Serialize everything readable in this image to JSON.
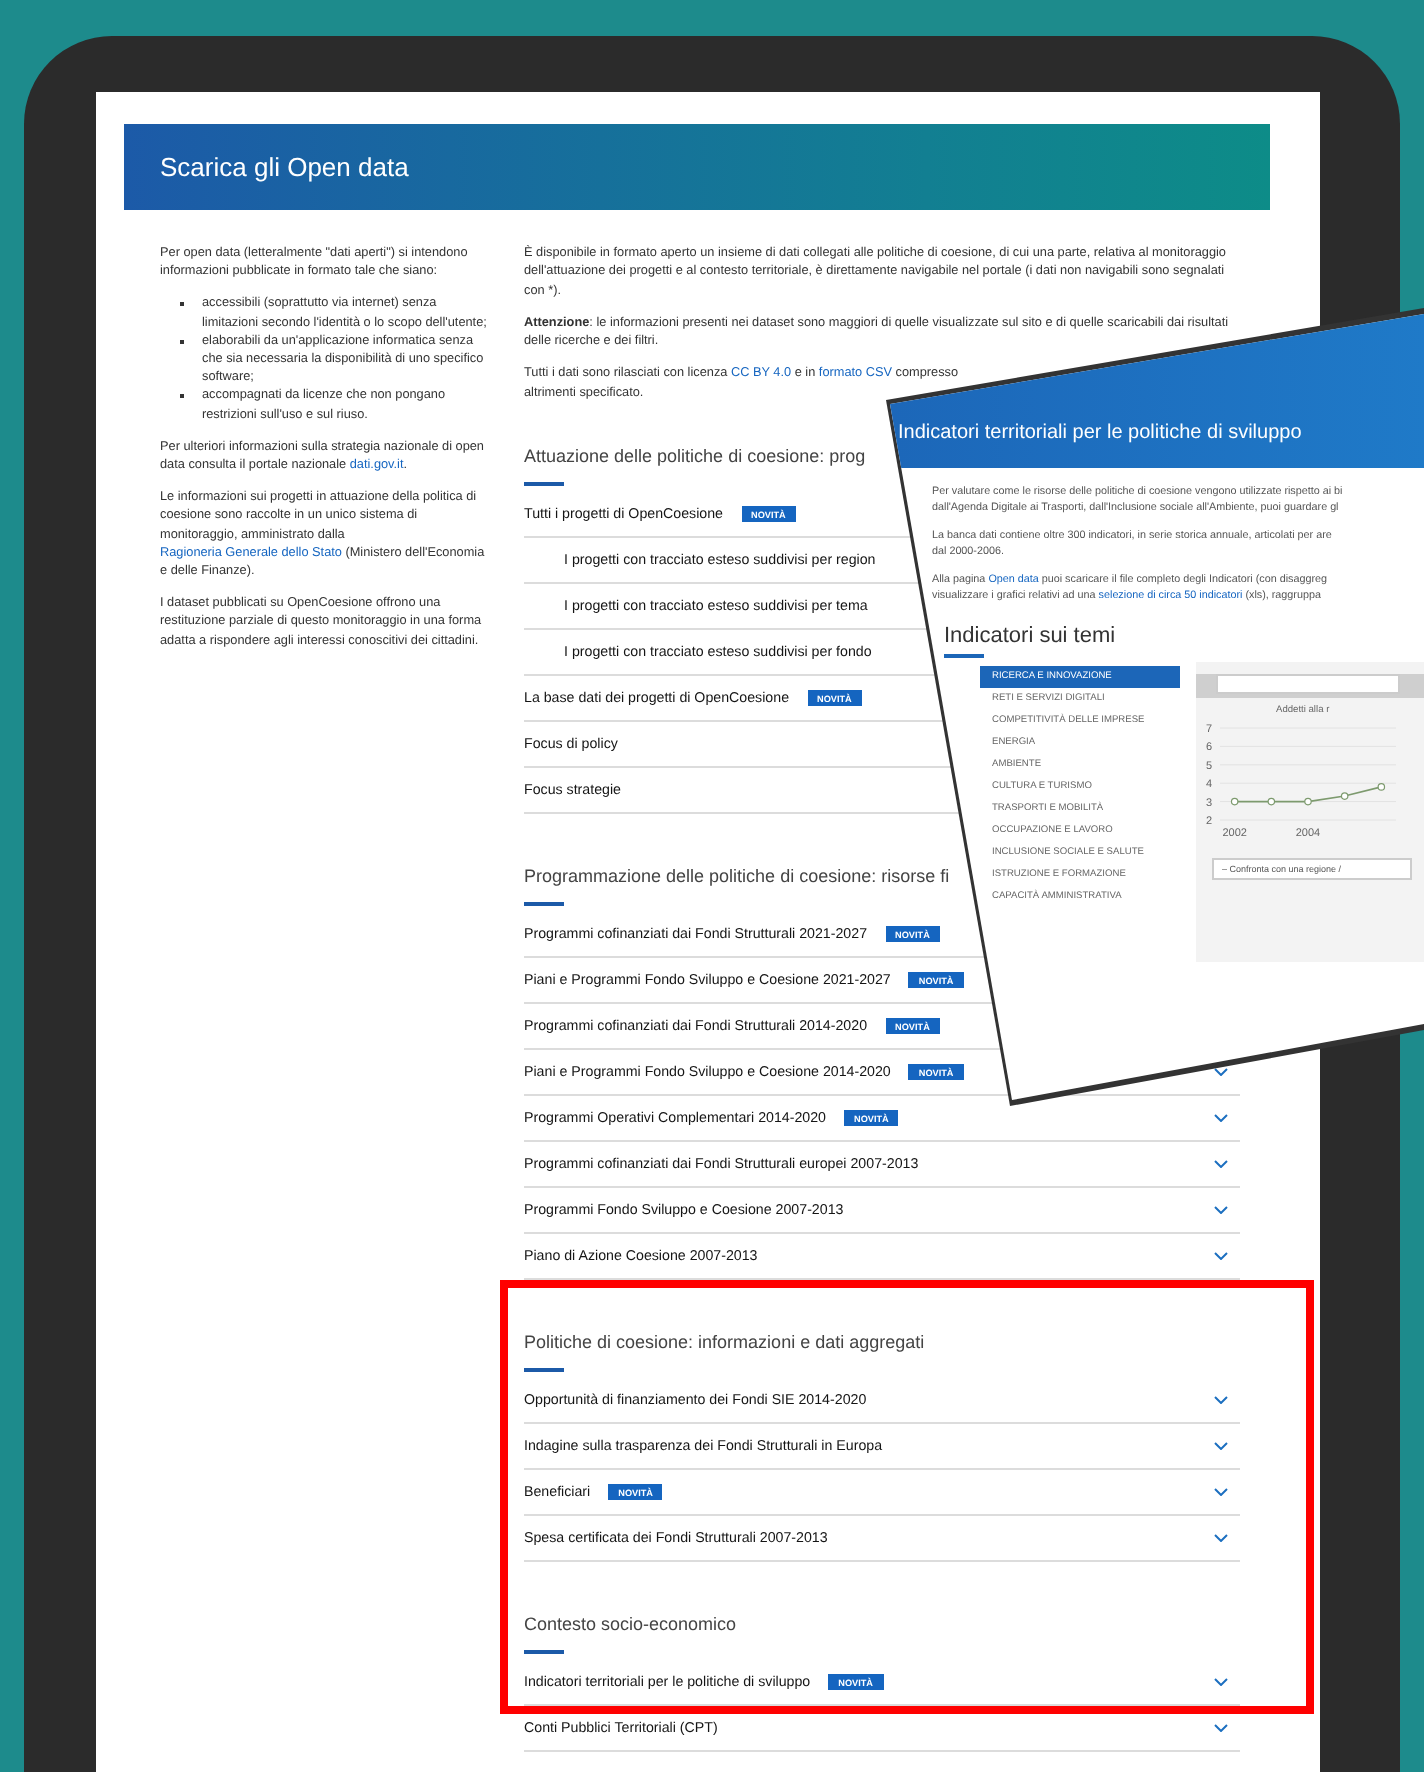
{
  "header": {
    "title": "Scarica gli Open data"
  },
  "left_column": {
    "intro": "Per open data (letteralmente \"dati aperti\") si intendono informazioni pubblicate in formato tale che siano:",
    "bullets": [
      "accessibili (soprattutto via internet) senza limitazioni secondo l'identità o lo scopo dell'utente;",
      "elaborabili da un'applicazione informatica senza che sia necessaria la disponibilità di uno specifico software;",
      "accompagnati da licenze che non pongano restrizioni sull'uso e sul riuso."
    ],
    "paragraphs": [
      [
        {
          "kind": "text",
          "text": "Per ulteriori informazioni sulla strategia nazionale di open data consulta il portale nazionale "
        },
        {
          "kind": "link",
          "text": "dati.gov.it"
        },
        {
          "kind": "text",
          "text": "."
        }
      ],
      [
        {
          "kind": "text",
          "text": "Le informazioni sui progetti in attuazione della politica di coesione sono raccolte in un unico sistema di monitoraggio, amministrato dalla "
        },
        {
          "kind": "link",
          "text": "Ragioneria Generale dello Stato"
        },
        {
          "kind": "text",
          "text": " (Ministero dell'Economia e delle Finanze)."
        }
      ],
      [
        {
          "kind": "text",
          "text": "I dataset pubblicati su OpenCoesione offrono una restituzione parziale di questo monitoraggio in una forma adatta a rispondere agli interessi conoscitivi dei cittadini."
        }
      ]
    ]
  },
  "right_column": {
    "paragraphs": [
      [
        {
          "kind": "text",
          "text": "È disponibile in formato aperto un insieme di dati collegati alle politiche di coesione, di cui una parte, relativa al monitoraggio dell'attuazione dei progetti e al contesto territoriale, è direttamente navigabile nel portale (i dati non navigabili sono segnalati con *)."
        }
      ],
      [
        {
          "kind": "text",
          "text": "**Attenzione**: le informazioni presenti nei dataset sono maggiori di quelle visualizzate sul sito e di quelle scaricabili dai risultati delle ricerche e dei filtri."
        }
      ],
      [
        {
          "kind": "text",
          "text": "Tutti i dati sono rilasciati con licenza "
        },
        {
          "kind": "link",
          "text": "CC BY 4.0"
        },
        {
          "kind": "text",
          "text": " e in "
        },
        {
          "kind": "link",
          "text": "formato CSV"
        },
        {
          "kind": "text",
          "text": " compresso"
        },
        {
          "kind": "break"
        },
        {
          "kind": "text",
          "text": "altrimenti specificato."
        }
      ]
    ],
    "sections": [
      {
        "title": "Attuazione delle politiche di coesione: prog",
        "rows": [
          {
            "label": "Tutti i progetti di OpenCoesione",
            "badge": "NOVITÀ",
            "children": [
              {
                "label": "I progetti con tracciato esteso suddivisi per region"
              },
              {
                "label": "I progetti con tracciato esteso suddivisi per tema"
              },
              {
                "label": "I progetti con tracciato esteso suddivisi per fondo"
              }
            ]
          },
          {
            "label": "La base dati dei progetti di OpenCoesione",
            "badge": "NOVITÀ"
          },
          {
            "label": "Focus di policy"
          },
          {
            "label": "Focus strategie"
          }
        ]
      },
      {
        "title": "Programmazione delle politiche di coesione: risorse fi",
        "rows": [
          {
            "label": "Programmi cofinanziati dai Fondi Strutturali 2021-2027",
            "badge": "NOVITÀ"
          },
          {
            "label": "Piani e Programmi Fondo Sviluppo e Coesione 2021-2027",
            "badge": "NOVITÀ"
          },
          {
            "label": "Programmi cofinanziati dai Fondi Strutturali 2014-2020",
            "badge": "NOVITÀ"
          },
          {
            "label": "Piani e Programmi Fondo Sviluppo e Coesione 2014-2020",
            "badge": "NOVITÀ"
          },
          {
            "label": "Programmi Operativi Complementari 2014-2020",
            "badge": "NOVITÀ"
          },
          {
            "label": "Programmi cofinanziati dai Fondi Strutturali europei 2007-2013"
          },
          {
            "label": "Programmi Fondo Sviluppo e Coesione 2007-2013"
          },
          {
            "label": "Piano di Azione Coesione 2007-2013"
          }
        ]
      },
      {
        "title": "Politiche di coesione: informazioni e dati aggregati",
        "rows": [
          {
            "label": "Opportunità di finanziamento dei Fondi SIE 2014-2020"
          },
          {
            "label": "Indagine sulla trasparenza dei Fondi Strutturali in Europa"
          },
          {
            "label": "Beneficiari",
            "badge": "NOVITÀ"
          },
          {
            "label": "Spesa certificata dei Fondi Strutturali 2007-2013"
          }
        ]
      },
      {
        "title": "Contesto socio-economico",
        "rows": [
          {
            "label": "Indicatori territoriali per le politiche di sviluppo",
            "badge": "NOVITÀ"
          },
          {
            "label": "Conti Pubblici Territoriali (CPT)"
          }
        ]
      }
    ]
  },
  "overlay_card": {
    "title": "Indicatori territoriali per le politiche di sviluppo",
    "paragraphs": [
      [
        {
          "kind": "text",
          "text": "Per valutare come le risorse delle politiche di coesione vengono utilizzate rispetto ai bi"
        },
        {
          "kind": "break"
        },
        {
          "kind": "text",
          "text": "dall'Agenda Digitale ai Trasporti, dall'Inclusione sociale all'Ambiente, puoi guardare gl"
        }
      ],
      [
        {
          "kind": "text",
          "text": "La banca dati contiene oltre 300 indicatori, in serie storica annuale, articolati per are"
        },
        {
          "kind": "break"
        },
        {
          "kind": "text",
          "text": "dal 2000-2006."
        }
      ],
      [
        {
          "kind": "text",
          "text": "Alla pagina "
        },
        {
          "kind": "link",
          "text": "Open data"
        },
        {
          "kind": "text",
          "text": " puoi scaricare il file completo degli Indicatori (con disaggreg"
        },
        {
          "kind": "break"
        },
        {
          "kind": "text",
          "text": "visualizzare i grafici relativi ad una "
        },
        {
          "kind": "link",
          "text": "selezione di circa 50 indicatori"
        },
        {
          "kind": "text",
          "text": " (xls), raggruppa"
        }
      ]
    ],
    "menu_title": "Indicatori sui temi",
    "menu": [
      {
        "label": "RICERCA E INNOVAZIONE",
        "selected": true
      },
      {
        "label": "RETI E SERVIZI DIGITALI",
        "selected": false
      },
      {
        "label": "COMPETITIVITÀ DELLE IMPRESE",
        "selected": false
      },
      {
        "label": "ENERGIA",
        "selected": false
      },
      {
        "label": "AMBIENTE",
        "selected": false
      },
      {
        "label": "CULTURA E TURISMO",
        "selected": false
      },
      {
        "label": "TRASPORTI E MOBILITÀ",
        "selected": false
      },
      {
        "label": "OCCUPAZIONE E LAVORO",
        "selected": false
      },
      {
        "label": "INCLUSIONE SOCIALE E SALUTE",
        "selected": false
      },
      {
        "label": "ISTRUZIONE E FORMAZIONE",
        "selected": false
      },
      {
        "label": "CAPACITÀ AMMINISTRATIVA",
        "selected": false
      }
    ],
    "chart_subtitle": "Addetti alla r",
    "compare_select": "– Confronta con una regione /",
    "chart_data": {
      "type": "line",
      "x": [
        2002,
        2003,
        2004,
        2005,
        2006
      ],
      "series": [
        {
          "color": "#7d9a6e",
          "marker": "circle",
          "values": [
            3,
            3,
            3,
            3.3,
            3.8
          ]
        }
      ],
      "grid": true,
      "xlim": [
        2001.6,
        2006.4
      ],
      "ylim": [
        2,
        7
      ],
      "xticks": [
        2002,
        2004
      ],
      "yticks": [
        2,
        3,
        4,
        5,
        6,
        7
      ]
    }
  }
}
